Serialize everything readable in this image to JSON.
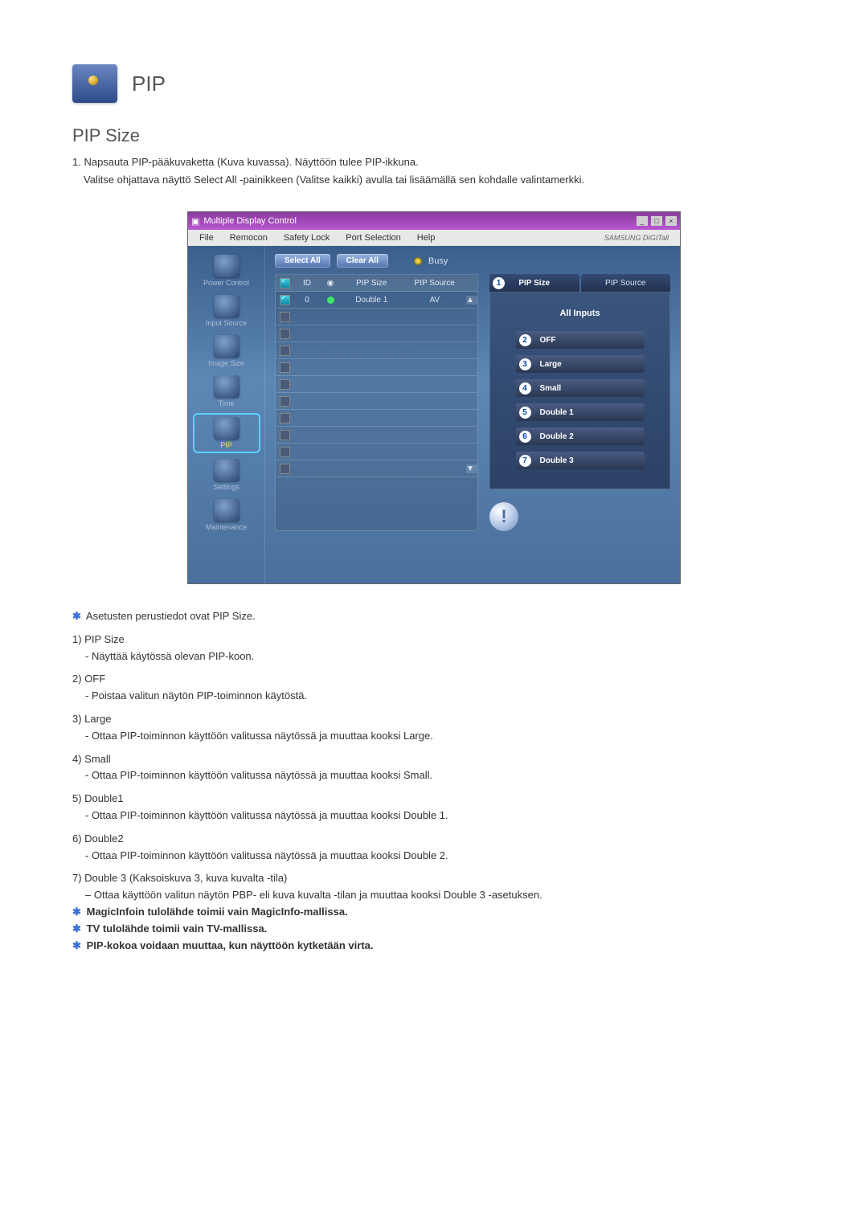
{
  "header": {
    "title": "PIP"
  },
  "section_title": "PIP Size",
  "intro": {
    "line1": "1.  Napsauta PIP-pääkuvaketta (Kuva kuvassa). Näyttöön tulee PIP-ikkuna.",
    "line2": "Valitse ohjattava näyttö Select All -painikkeen (Valitse kaikki) avulla tai lisäämällä sen kohdalle valintamerkki."
  },
  "window": {
    "title": "Multiple Display Control",
    "menus": [
      "File",
      "Remocon",
      "Safety Lock",
      "Port Selection",
      "Help"
    ],
    "brand": "SAMSUNG DIGITall",
    "sidebar": [
      "Power Control",
      "Input Source",
      "Image Size",
      "Time",
      "PIP",
      "Settings",
      "Maintenance"
    ],
    "buttons": {
      "select_all": "Select All",
      "clear_all": "Clear All",
      "busy": "Busy"
    },
    "table": {
      "headers": {
        "id": "ID",
        "pipsize": "PIP Size",
        "pipsource": "PIP Source"
      },
      "row": {
        "id": "0",
        "pipsize": "Double 1",
        "pipsource": "AV"
      }
    },
    "tabs": {
      "size": "PIP Size",
      "source": "PIP Source",
      "all_inputs": "All Inputs"
    },
    "options": [
      {
        "n": "2",
        "label": "OFF"
      },
      {
        "n": "3",
        "label": "Large"
      },
      {
        "n": "4",
        "label": "Small"
      },
      {
        "n": "5",
        "label": "Double 1"
      },
      {
        "n": "6",
        "label": "Double 2"
      },
      {
        "n": "7",
        "label": "Double 3"
      }
    ]
  },
  "notes": {
    "star1": "Asetusten perustiedot ovat PIP Size.",
    "items": [
      {
        "num": "1)",
        "title": "PIP Size",
        "desc": "- Näyttää käytössä olevan PIP-koon."
      },
      {
        "num": "2)",
        "title": "OFF",
        "desc": "- Poistaa valitun näytön PIP-toiminnon käytöstä."
      },
      {
        "num": "3)",
        "title": "Large",
        "desc": "- Ottaa PIP-toiminnon käyttöön valitussa näytössä ja muuttaa kooksi Large."
      },
      {
        "num": "4)",
        "title": "Small",
        "desc": "- Ottaa PIP-toiminnon käyttöön valitussa näytössä ja muuttaa kooksi Small."
      },
      {
        "num": "5)",
        "title": "Double1",
        "desc": "- Ottaa PIP-toiminnon käyttöön valitussa näytössä ja muuttaa kooksi Double 1."
      },
      {
        "num": "6)",
        "title": "Double2",
        "desc": "- Ottaa PIP-toiminnon käyttöön valitussa näytössä ja muuttaa kooksi Double 2."
      },
      {
        "num": "7)",
        "title": "Double 3 (Kaksoiskuva 3, kuva kuvalta -tila)",
        "desc": "– Ottaa käyttöön valitun näytön PBP- eli kuva kuvalta -tilan ja muuttaa kooksi Double 3 -asetuksen."
      }
    ],
    "star2": "MagicInfoin tulolähde toimii vain MagicInfo-mallissa.",
    "star3": "TV tulolähde toimii vain TV-mallissa.",
    "star4": "PIP-kokoa voidaan muuttaa, kun näyttöön kytketään virta."
  }
}
